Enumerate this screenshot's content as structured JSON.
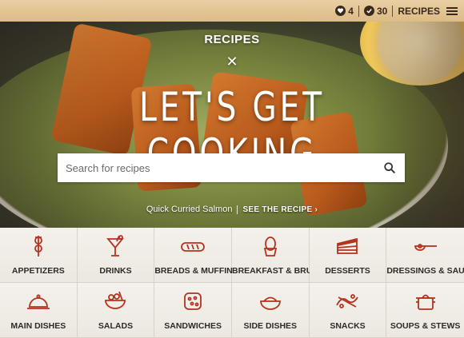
{
  "topbar": {
    "favorites_count": "4",
    "checked_count": "30",
    "section_label": "RECIPES"
  },
  "hero": {
    "kicker": "RECIPES",
    "divider": "✕",
    "title": "LET'S GET COOKING",
    "search_placeholder": "Search for recipes",
    "caption_recipe": "Quick Curried Salmon",
    "caption_link": "SEE THE RECIPE ›"
  },
  "categories": [
    {
      "label": "APPETIZERS",
      "icon": "skewer-icon"
    },
    {
      "label": "DRINKS",
      "icon": "cocktail-icon"
    },
    {
      "label": "BREADS & MUFFINS",
      "icon": "bread-icon"
    },
    {
      "label": "BREAKFAST & BRUNCH",
      "icon": "egg-icon"
    },
    {
      "label": "DESSERTS",
      "icon": "cake-icon"
    },
    {
      "label": "DRESSINGS & SAUCES",
      "icon": "ladle-icon"
    },
    {
      "label": "MAIN DISHES",
      "icon": "cloche-icon"
    },
    {
      "label": "SALADS",
      "icon": "salad-bowl-icon"
    },
    {
      "label": "SANDWICHES",
      "icon": "sandwich-icon"
    },
    {
      "label": "SIDE DISHES",
      "icon": "bowl-icon"
    },
    {
      "label": "SNACKS",
      "icon": "pretzel-icon"
    },
    {
      "label": "SOUPS & STEWS",
      "icon": "pot-icon"
    }
  ],
  "colors": {
    "icon_red": "#b5321f",
    "topbar_wood": "#dcbb86",
    "label_text": "#2e2a26"
  }
}
